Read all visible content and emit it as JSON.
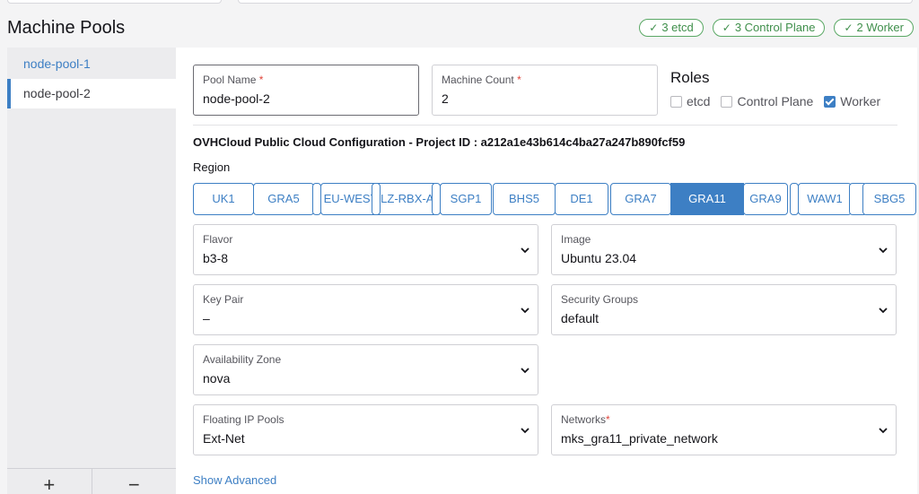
{
  "page_title": "Machine Pools",
  "badges": [
    {
      "label": "3 etcd"
    },
    {
      "label": "3 Control Plane"
    },
    {
      "label": "2 Worker"
    }
  ],
  "sidebar": {
    "items": [
      {
        "label": "node-pool-1"
      },
      {
        "label": "node-pool-2"
      }
    ],
    "add_label": "+",
    "remove_label": "−"
  },
  "form": {
    "pool_name": {
      "label": "Pool Name",
      "required": "*",
      "value": "node-pool-2"
    },
    "machine_count": {
      "label": "Machine Count",
      "required": "*",
      "value": "2"
    },
    "roles_title": "Roles",
    "roles": [
      {
        "label": "etcd",
        "checked": false
      },
      {
        "label": "Control Plane",
        "checked": false
      },
      {
        "label": "Worker",
        "checked": true
      }
    ],
    "config_title": "OVHCloud Public Cloud Configuration - Project ID : a212a1e43b614c4ba27a247b890fcf59",
    "region_label": "Region",
    "regions": [
      "UK1",
      "GRA5",
      "EU-WEST-LZ-RBX-A",
      "SGP1",
      "BHS5",
      "DE1",
      "GRA7",
      "GRA11",
      "GRA9",
      "WAW1",
      "SBG5"
    ],
    "selected_region": "GRA11",
    "flavor": {
      "label": "Flavor",
      "value": "b3-8"
    },
    "image": {
      "label": "Image",
      "value": "Ubuntu 23.04"
    },
    "key_pair": {
      "label": "Key Pair",
      "value": "–"
    },
    "security_groups": {
      "label": "Security Groups",
      "value": "default"
    },
    "availability_zone": {
      "label": "Availability Zone",
      "value": "nova"
    },
    "floating_ip_pools": {
      "label": "Floating IP Pools",
      "value": "Ext-Net"
    },
    "networks": {
      "label": "Networks",
      "required": "*",
      "value": "mks_gra11_private_network"
    },
    "show_advanced": "Show Advanced"
  },
  "colors": {
    "accent": "#3d7fc4",
    "success": "#3f8f4b",
    "required": "#e0453b"
  },
  "icons": {
    "badge": "check-icon",
    "select": "chevron-down-icon"
  }
}
